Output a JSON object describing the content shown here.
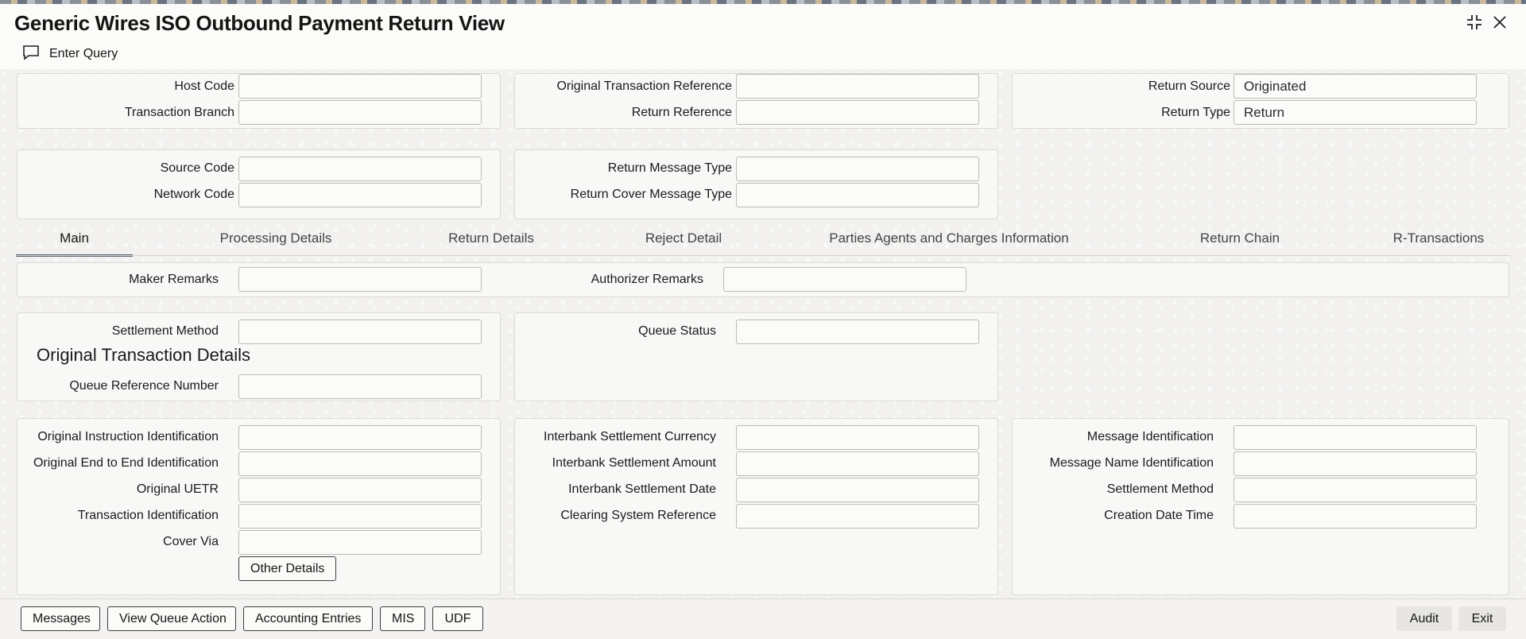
{
  "window": {
    "title": "Generic Wires ISO Outbound Payment Return View",
    "icons": {
      "maximize": "expand-icon",
      "close": "close-icon"
    }
  },
  "toolbar": {
    "enter_query_label": "Enter Query",
    "icon": "speech-bubble-icon"
  },
  "header": {
    "host_code_label": "Host Code",
    "host_code_value": "",
    "transaction_branch_label": "Transaction Branch",
    "transaction_branch_value": "",
    "original_transaction_reference_label": "Original Transaction Reference",
    "original_transaction_reference_value": "",
    "return_reference_label": "Return Reference",
    "return_reference_value": "",
    "return_source_label": "Return Source",
    "return_source_value": "Originated",
    "return_type_label": "Return Type",
    "return_type_value": "Return",
    "source_code_label": "Source Code",
    "source_code_value": "",
    "network_code_label": "Network Code",
    "network_code_value": "",
    "return_message_type_label": "Return Message Type",
    "return_message_type_value": "",
    "return_cover_message_type_label": "Return Cover Message Type",
    "return_cover_message_type_value": ""
  },
  "tabs": [
    {
      "label": "Main",
      "active": true
    },
    {
      "label": "Processing Details"
    },
    {
      "label": "Return Details"
    },
    {
      "label": "Reject Detail"
    },
    {
      "label": "Parties Agents and Charges Information"
    },
    {
      "label": "Return Chain"
    },
    {
      "label": "R-Transactions"
    }
  ],
  "remarks": {
    "maker_remarks_label": "Maker Remarks",
    "maker_remarks_value": "",
    "authorizer_remarks_label": "Authorizer Remarks",
    "authorizer_remarks_value": ""
  },
  "settlement": {
    "settlement_method_label": "Settlement Method",
    "settlement_method_value": "",
    "queue_status_label": "Queue Status",
    "queue_status_value": "",
    "section_title": "Original Transaction Details",
    "queue_reference_number_label": "Queue Reference Number",
    "queue_reference_number_value": ""
  },
  "original": {
    "instruction_id_label": "Original Instruction Identification",
    "instruction_id_value": "",
    "end_to_end_id_label": "Original End to End Identification",
    "end_to_end_id_value": "",
    "uetr_label": "Original UETR",
    "uetr_value": "",
    "transaction_id_label": "Transaction Identification",
    "transaction_id_value": "",
    "cover_via_label": "Cover Via",
    "cover_via_value": "",
    "other_details_label": "Other Details",
    "interbank_currency_label": "Interbank Settlement Currency",
    "interbank_currency_value": "",
    "interbank_amount_label": "Interbank Settlement Amount",
    "interbank_amount_value": "",
    "interbank_date_label": "Interbank Settlement Date",
    "interbank_date_value": "",
    "clearing_ref_label": "Clearing System Reference",
    "clearing_ref_value": "",
    "message_id_label": "Message Identification",
    "message_id_value": "",
    "message_name_id_label": "Message Name Identification",
    "message_name_id_value": "",
    "settlement_method_label": "Settlement Method",
    "settlement_method_value": "",
    "creation_datetime_label": "Creation Date Time",
    "creation_datetime_value": ""
  },
  "footer": {
    "messages_label": "Messages",
    "view_queue_action_label": "View Queue Action",
    "accounting_entries_label": "Accounting Entries",
    "mis_label": "MIS",
    "udf_label": "UDF",
    "audit_label": "Audit",
    "exit_label": "Exit"
  }
}
